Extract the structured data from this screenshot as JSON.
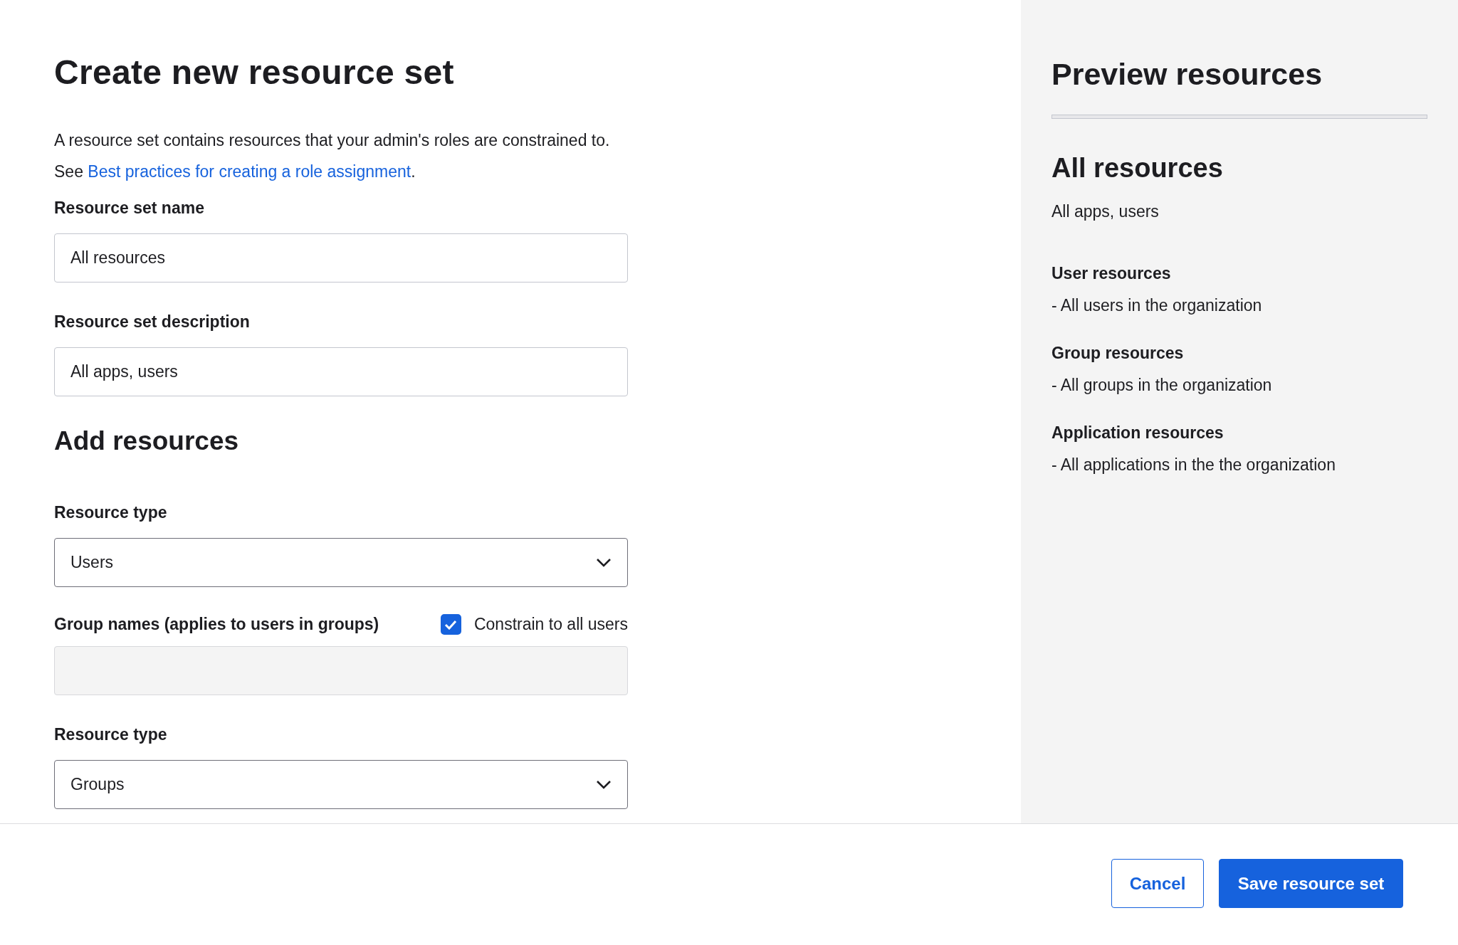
{
  "form": {
    "title": "Create new resource set",
    "intro": {
      "text": "A resource set contains resources that your admin's roles are constrained to. See ",
      "link": "Best practices for creating a role assignment",
      "end": "."
    },
    "fields": [
      {
        "kind": "text",
        "label": "Resource set name",
        "value": "All resources"
      },
      {
        "kind": "text",
        "label": "Resource set description",
        "value": "All apps, users"
      }
    ],
    "resources_heading": "Add resources",
    "resources": [
      {
        "kind": "select",
        "label": "Resource type",
        "value": "Users"
      },
      {
        "kind": "group",
        "label": "Group names (applies to users in groups)",
        "checkbox": {
          "label": "Constrain to all users",
          "checked": true
        },
        "disabled": true
      },
      {
        "kind": "select",
        "label": "Resource type",
        "value": "Groups"
      }
    ]
  },
  "preview": {
    "title": "Preview resources",
    "name": "All resources",
    "description": "All apps, users",
    "sections": [
      {
        "title": "User resources",
        "items": [
          "- All users in the organization"
        ]
      },
      {
        "title": "Group resources",
        "items": [
          "- All groups in the organization"
        ]
      },
      {
        "title": "Application resources",
        "items": [
          "- All applications in the the organization"
        ]
      }
    ]
  },
  "footer": {
    "buttons": [
      {
        "label": "Cancel",
        "kind": "secondary"
      },
      {
        "label": "Save resource set",
        "kind": "primary"
      }
    ]
  }
}
